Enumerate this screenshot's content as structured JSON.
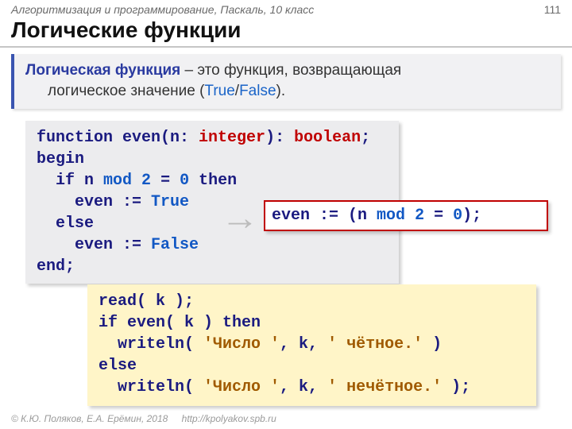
{
  "header": {
    "chapter": "Алгоритмизация и программирование, Паскаль, 10 класс",
    "slide_number": "111",
    "title": "Логические функции"
  },
  "definition": {
    "term": "Логическая функция",
    "dash": " – ",
    "body_line1": "это функция, возвращающая",
    "body_line2": "логическое значение (",
    "true": "True",
    "slash": "/",
    "false": "False",
    "close": ")."
  },
  "code1": {
    "l1a": "function even(n: ",
    "l1b": "integer",
    "l1c": "): ",
    "l1d": "boolean",
    "l1e": ";",
    "l2": "begin",
    "l3a": "  if n ",
    "l3b": "mod",
    "l3c": " ",
    "l3d": "2",
    "l3e": " = ",
    "l3f": "0",
    "l3g": " then",
    "l4a": "    even := ",
    "l4b": "True",
    "l5": "  else",
    "l6a": "    even := ",
    "l6b": "False",
    "l7": "end;"
  },
  "arrow": "→",
  "short": {
    "a": "even := (n ",
    "b": "mod",
    "c": " ",
    "d": "2",
    "e": " = ",
    "f": "0",
    "g": ");"
  },
  "usage": {
    "l1": "read( k );",
    "l2": "if even( k ) then",
    "l3a": "  writeln( ",
    "l3b": "'Число '",
    "l3c": ", k, ",
    "l3d": "' чётное.'",
    "l3e": " )",
    "l4": "else",
    "l5a": "  writeln( ",
    "l5b": "'Число '",
    "l5c": ", k, ",
    "l5d": "' нечётное.'",
    "l5e": " );"
  },
  "footer": {
    "copyright": "© К.Ю. Поляков, Е.А. Ерёмин, 2018",
    "url": "http://kpolyakov.spb.ru"
  }
}
